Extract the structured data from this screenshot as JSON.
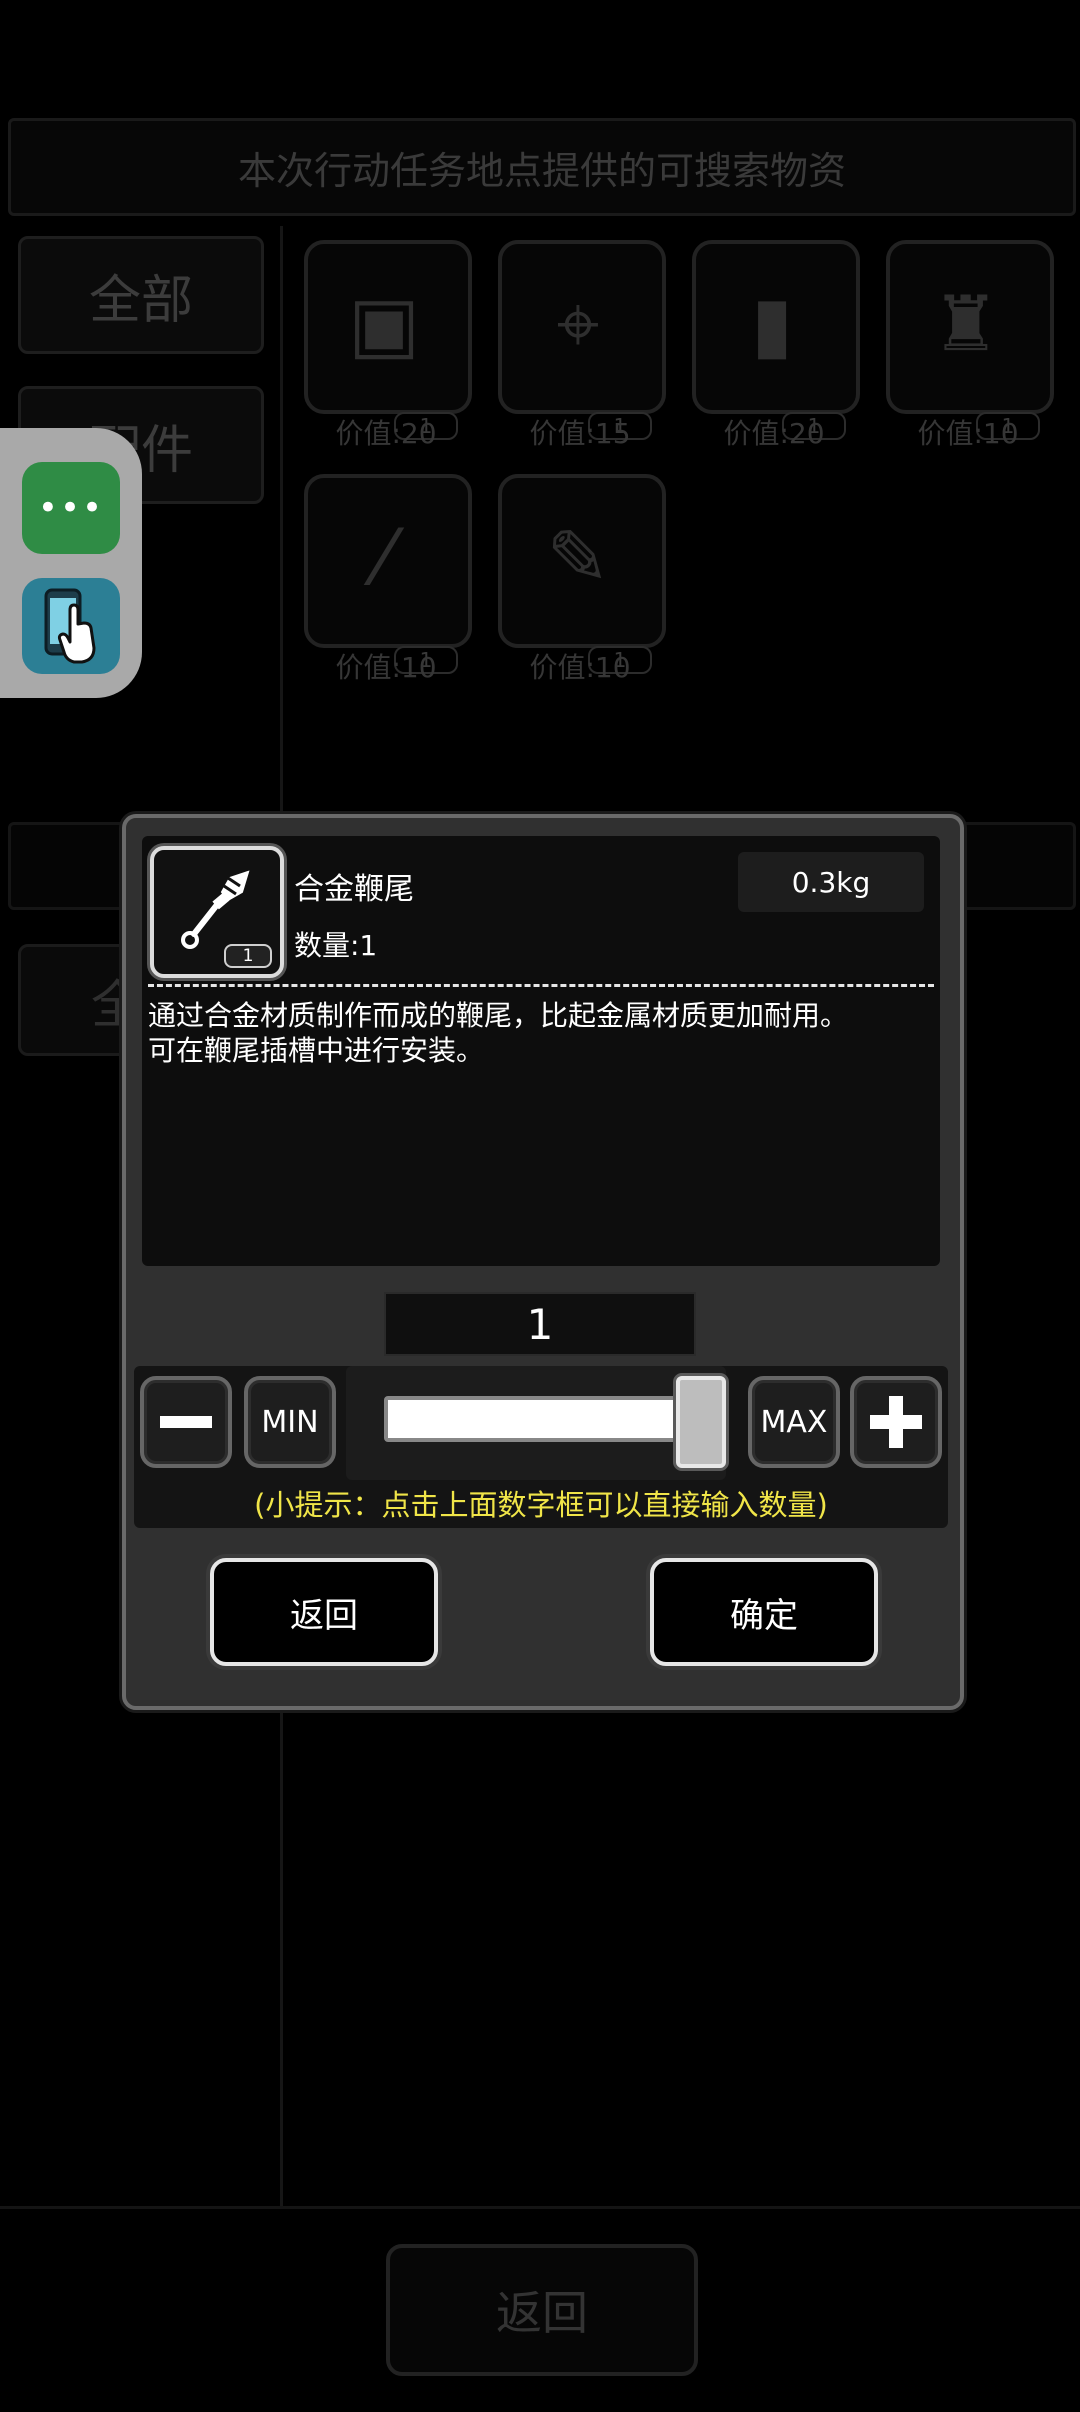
{
  "background": {
    "banner_text": "本次行动任务地点提供的可搜索物资",
    "tabs": [
      "全部",
      "配件"
    ],
    "lower_tab": "全",
    "items": [
      {
        "icon": "backpack-icon",
        "glyph": "▣",
        "count": "1",
        "value": "价值:20"
      },
      {
        "icon": "scope-icon",
        "glyph": "⌖",
        "count": "1",
        "value": "价值:15"
      },
      {
        "icon": "grip-icon",
        "glyph": "▮",
        "count": "1",
        "value": "价值:20"
      },
      {
        "icon": "spiked-guard-icon",
        "glyph": "♜",
        "count": "1",
        "value": "价值:10"
      },
      {
        "icon": "blade-icon",
        "glyph": "⁄",
        "count": "1",
        "value": "价值:10"
      },
      {
        "icon": "whip-tip-icon",
        "glyph": "✎",
        "count": "1",
        "value": "价值:10"
      }
    ],
    "back_label": "返回"
  },
  "floating_widget": {
    "more_label": "•••",
    "colors": {
      "more": "#2f8c45",
      "touch": "#2c7f95"
    }
  },
  "dialog": {
    "item": {
      "name": "合金鞭尾",
      "quantity_label": "数量:1",
      "weight": "0.3kg",
      "icon_count": "1",
      "description_lines": [
        "通过合金材质制作而成的鞭尾，比起金属材质更加耐用。",
        "可在鞭尾插槽中进行安装。"
      ]
    },
    "quantity_input": "1",
    "slider": {
      "value": 1,
      "min": 1,
      "max": 1
    },
    "buttons": {
      "minus": "−",
      "min": "MIN",
      "max": "MAX",
      "plus": "+",
      "back": "返回",
      "confirm": "确定"
    },
    "hint": "(小提示：点击上面数字框可以直接输入数量)",
    "colors": {
      "hint": "#f0e548",
      "panel": "#303030"
    }
  }
}
